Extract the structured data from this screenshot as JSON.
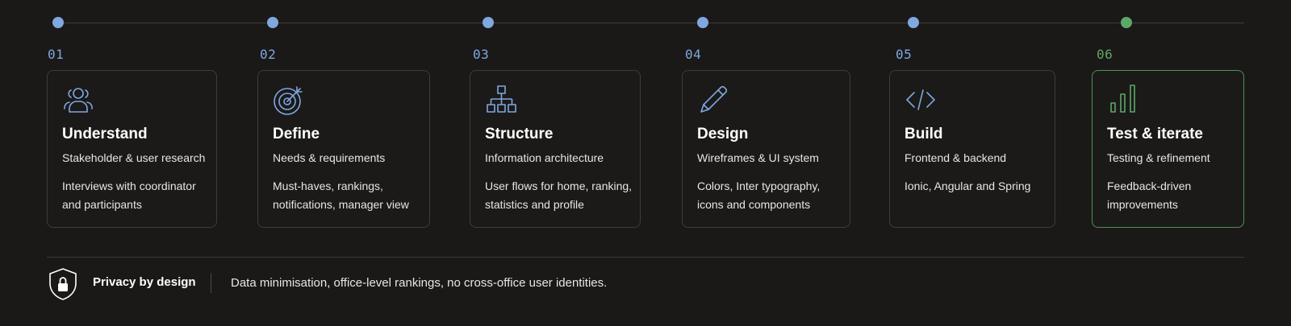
{
  "colors": {
    "background": "#1a1918",
    "accent_blue": "#7fa7e0",
    "accent_green": "#5ea867",
    "card_border": "#3d3c3a"
  },
  "steps": [
    {
      "number": "01",
      "title": "Understand",
      "subtitle": "Stakeholder & user research",
      "description": "Interviews with coordinator and participants",
      "icon": "users-icon",
      "color": "#7fa7e0"
    },
    {
      "number": "02",
      "title": "Define",
      "subtitle": "Needs & requirements",
      "description": "Must-haves, rankings, notifications, manager view",
      "icon": "target-icon",
      "color": "#7fa7e0"
    },
    {
      "number": "03",
      "title": "Structure",
      "subtitle": "Information architecture",
      "description": "User flows for home, ranking, statistics and profile",
      "icon": "sitemap-icon",
      "color": "#7fa7e0"
    },
    {
      "number": "04",
      "title": "Design",
      "subtitle": "Wireframes & UI system",
      "description": "Colors, Inter typography, icons and components",
      "icon": "pencil-icon",
      "color": "#7fa7e0"
    },
    {
      "number": "05",
      "title": "Build",
      "subtitle": "Frontend & backend",
      "description": "Ionic, Angular and Spring",
      "icon": "code-icon",
      "color": "#7fa7e0"
    },
    {
      "number": "06",
      "title": "Test & iterate",
      "subtitle": "Testing & refinement",
      "description": "Feedback-driven improvements",
      "icon": "bar-chart-icon",
      "color": "#5ea867"
    }
  ],
  "privacy": {
    "title": "Privacy by design",
    "text": "Data minimisation, office-level rankings, no cross-office user identities.",
    "icon": "shield-lock-icon"
  }
}
